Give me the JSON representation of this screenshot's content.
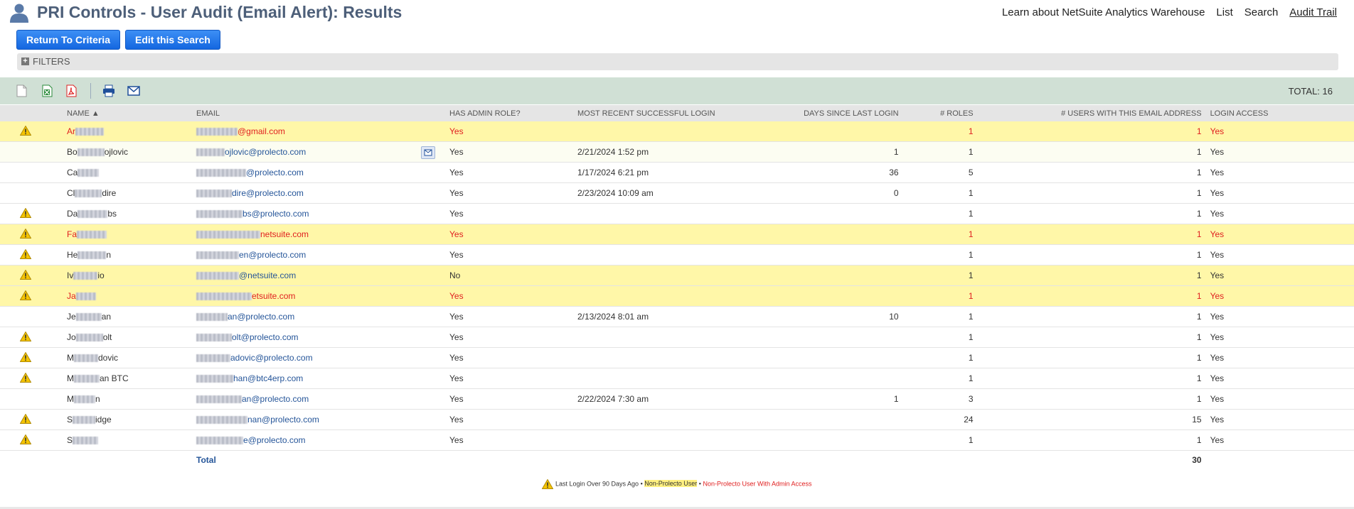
{
  "header": {
    "title": "PRI Controls - User Audit (Email Alert): Results",
    "links": [
      "Learn about NetSuite Analytics Warehouse",
      "List",
      "Search",
      "Audit Trail"
    ]
  },
  "buttons": {
    "return": "Return To Criteria",
    "edit": "Edit this Search"
  },
  "filters": {
    "label": "FILTERS"
  },
  "toolbar": {
    "icons": [
      "export-csv-icon",
      "export-excel-icon",
      "export-pdf-icon",
      "print-icon",
      "email-icon"
    ],
    "total": "TOTAL: 16"
  },
  "columns": [
    "NAME ▲",
    "EMAIL",
    "HAS ADMIN ROLE?",
    "MOST RECENT SUCCESSFUL LOGIN",
    "DAYS SINCE LAST LOGIN",
    "# ROLES",
    "# USERS WITH THIS EMAIL ADDRESS",
    "LOGIN ACCESS"
  ],
  "rows": [
    {
      "warn": true,
      "style": "yellow-red",
      "name_pre": "Ar",
      "name_post": "",
      "email_pre": "",
      "email_post": "@gmail.com",
      "admin": "Yes",
      "login": "",
      "days": "",
      "roles": "1",
      "users": "1",
      "access": "Yes"
    },
    {
      "warn": false,
      "style": "light",
      "name_pre": "Bo",
      "name_post": "ojlovic",
      "email_pre": "",
      "email_post": "ojlovic@prolecto.com",
      "admin": "Yes",
      "login": "2/21/2024 1:52 pm",
      "days": "1",
      "roles": "1",
      "users": "1",
      "access": "Yes",
      "mail_button": true
    },
    {
      "warn": false,
      "style": "normal",
      "name_pre": "Ca",
      "name_post": "",
      "email_pre": "",
      "email_post": "@prolecto.com",
      "admin": "Yes",
      "login": "1/17/2024 6:21 pm",
      "days": "36",
      "roles": "5",
      "users": "1",
      "access": "Yes"
    },
    {
      "warn": false,
      "style": "normal",
      "name_pre": "Cl",
      "name_post": "dire",
      "email_pre": "",
      "email_post": "dire@prolecto.com",
      "admin": "Yes",
      "login": "2/23/2024 10:09 am",
      "days": "0",
      "roles": "1",
      "users": "1",
      "access": "Yes"
    },
    {
      "warn": true,
      "style": "normal",
      "name_pre": "Da",
      "name_post": "bs",
      "email_pre": "",
      "email_post": "bs@prolecto.com",
      "admin": "Yes",
      "login": "",
      "days": "",
      "roles": "1",
      "users": "1",
      "access": "Yes"
    },
    {
      "warn": true,
      "style": "yellow-red",
      "name_pre": "Fa",
      "name_post": "",
      "email_pre": "",
      "email_post": "netsuite.com",
      "admin": "Yes",
      "login": "",
      "days": "",
      "roles": "1",
      "users": "1",
      "access": "Yes"
    },
    {
      "warn": true,
      "style": "normal",
      "name_pre": "He",
      "name_post": "n",
      "email_pre": "",
      "email_post": "en@prolecto.com",
      "admin": "Yes",
      "login": "",
      "days": "",
      "roles": "1",
      "users": "1",
      "access": "Yes"
    },
    {
      "warn": true,
      "style": "yellow",
      "name_pre": "Iv",
      "name_post": "io",
      "email_pre": "",
      "email_post": "@netsuite.com",
      "admin": "No",
      "login": "",
      "days": "",
      "roles": "1",
      "users": "1",
      "access": "Yes"
    },
    {
      "warn": true,
      "style": "yellow-red",
      "name_pre": "Ja",
      "name_post": "",
      "email_pre": "",
      "email_post": "etsuite.com",
      "admin": "Yes",
      "login": "",
      "days": "",
      "roles": "1",
      "users": "1",
      "access": "Yes"
    },
    {
      "warn": false,
      "style": "normal",
      "name_pre": "Je",
      "name_post": "an",
      "email_pre": "",
      "email_post": "an@prolecto.com",
      "admin": "Yes",
      "login": "2/13/2024 8:01 am",
      "days": "10",
      "roles": "1",
      "users": "1",
      "access": "Yes"
    },
    {
      "warn": true,
      "style": "normal",
      "name_pre": "Jo",
      "name_post": "olt",
      "email_pre": "",
      "email_post": "olt@prolecto.com",
      "admin": "Yes",
      "login": "",
      "days": "",
      "roles": "1",
      "users": "1",
      "access": "Yes"
    },
    {
      "warn": true,
      "style": "normal",
      "name_pre": "M",
      "name_post": "dovic",
      "email_pre": "",
      "email_post": "adovic@prolecto.com",
      "admin": "Yes",
      "login": "",
      "days": "",
      "roles": "1",
      "users": "1",
      "access": "Yes"
    },
    {
      "warn": true,
      "style": "normal",
      "name_pre": "M",
      "name_post": "an BTC",
      "email_pre": "",
      "email_post": "han@btc4erp.com",
      "admin": "Yes",
      "login": "",
      "days": "",
      "roles": "1",
      "users": "1",
      "access": "Yes"
    },
    {
      "warn": false,
      "style": "normal",
      "name_pre": "M",
      "name_post": "n",
      "email_pre": "",
      "email_post": "an@prolecto.com",
      "admin": "Yes",
      "login": "2/22/2024 7:30 am",
      "days": "1",
      "roles": "3",
      "users": "1",
      "access": "Yes"
    },
    {
      "warn": true,
      "style": "normal",
      "name_pre": "S",
      "name_post": "idge",
      "email_pre": "",
      "email_post": "nan@prolecto.com",
      "admin": "Yes",
      "login": "",
      "days": "",
      "roles": "24",
      "users": "15",
      "access": "Yes"
    },
    {
      "warn": true,
      "style": "normal",
      "name_pre": "S",
      "name_post": "",
      "email_pre": "",
      "email_post": "e@prolecto.com",
      "admin": "Yes",
      "login": "",
      "days": "",
      "roles": "1",
      "users": "1",
      "access": "Yes"
    }
  ],
  "total_row": {
    "label": "Total",
    "users": "30"
  },
  "legend": {
    "over90": "Last Login Over 90 Days Ago",
    "sep": "•",
    "nonprolecto": "Non-Prolecto User",
    "nonprolecto_admin": "Non-Prolecto User With Admin Access"
  },
  "colors": {
    "yellow_row": "#fff7a8",
    "red_text": "#e02020",
    "toolbar_bg": "#d0e0d5",
    "link_blue": "#255599",
    "button_blue": "#1467e0"
  }
}
